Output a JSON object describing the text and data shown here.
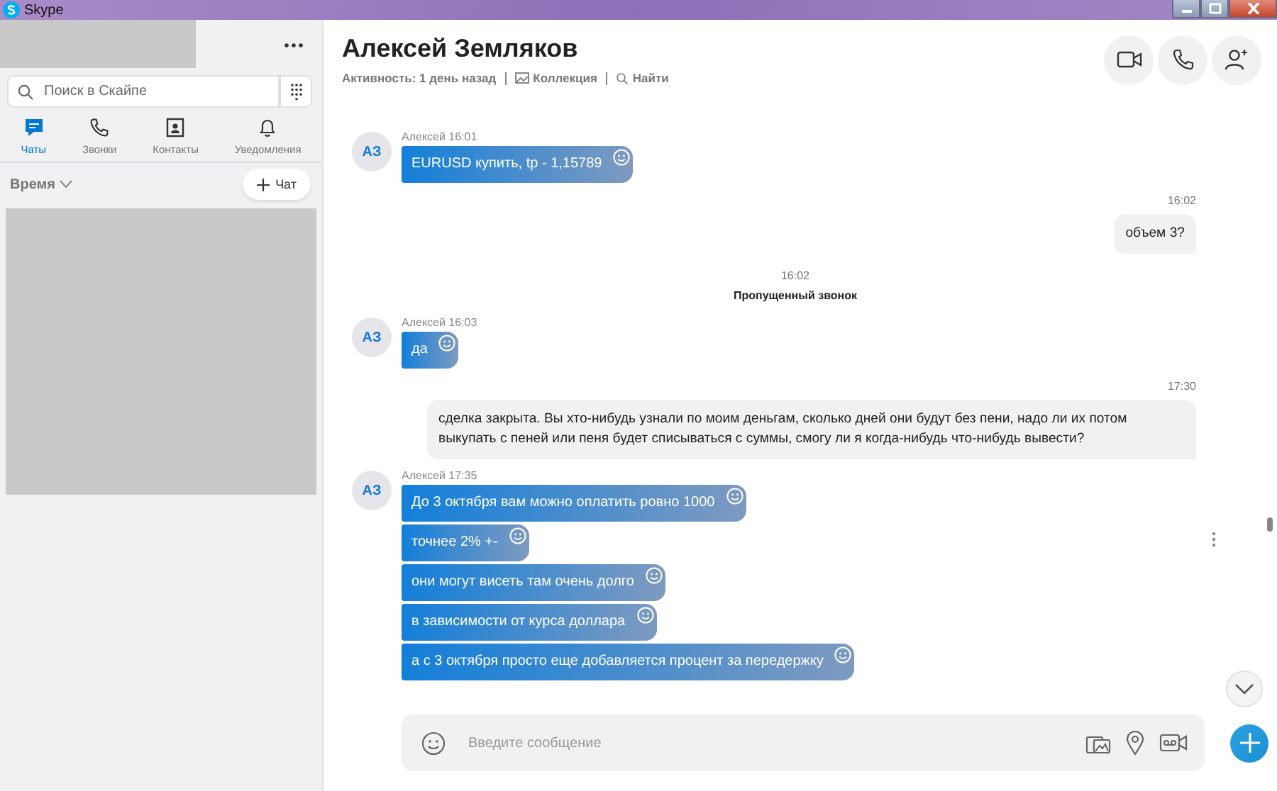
{
  "window": {
    "title": "Skype"
  },
  "sidebar": {
    "search": {
      "placeholder": "Поиск в Скайпе"
    },
    "tabs": [
      {
        "kind": "chats",
        "label": "Чаты",
        "selected": true
      },
      {
        "kind": "calls",
        "label": "Звонки",
        "selected": false
      },
      {
        "kind": "contacts",
        "label": "Контакты",
        "selected": false
      },
      {
        "kind": "notifications",
        "label": "Уведомления",
        "selected": false
      }
    ],
    "sort": {
      "label": "Время"
    },
    "new_chat_button": {
      "label": "Чат"
    }
  },
  "conversation": {
    "contact_name": "Алексей Земляков",
    "status": "Активность: 1 день назад",
    "links": [
      {
        "kind": "gallery",
        "label": "Коллекция"
      },
      {
        "kind": "search",
        "label": "Найти"
      }
    ]
  },
  "messages": [
    {
      "kind": "incoming",
      "avatar": "АЗ",
      "meta": "Алексей 16:01",
      "bubbles": [
        "EURUSD купить, tp - 1,15789"
      ]
    },
    {
      "kind": "outgoing",
      "time": "16:02",
      "text": "объем 3?"
    },
    {
      "kind": "system",
      "time": "16:02",
      "text": "Пропущенный звонок"
    },
    {
      "kind": "incoming",
      "avatar": "АЗ",
      "meta": "Алексей 16:03",
      "bubbles": [
        "да"
      ]
    },
    {
      "kind": "outgoing",
      "time": "17:30",
      "text": "сделка закрыта. Вы хто-нибудь узнали по моим деньгам, сколько дней они будут без пени, надо ли их потом выкупать с пеней или пеня будет списываться с суммы, смогу ли я когда-нибудь что-нибудь вывести?"
    },
    {
      "kind": "incoming",
      "avatar": "АЗ",
      "meta": "Алексей 17:35",
      "bubbles": [
        "До 3 октября вам можно оплатить ровно 1000",
        "точнее 2% +-",
        "они могут висеть там очень долго",
        "в зависимости от курса доллара",
        "а с 3 октября просто еще добавляется процент за передержку"
      ]
    }
  ],
  "composer": {
    "placeholder": "Введите сообщение"
  }
}
